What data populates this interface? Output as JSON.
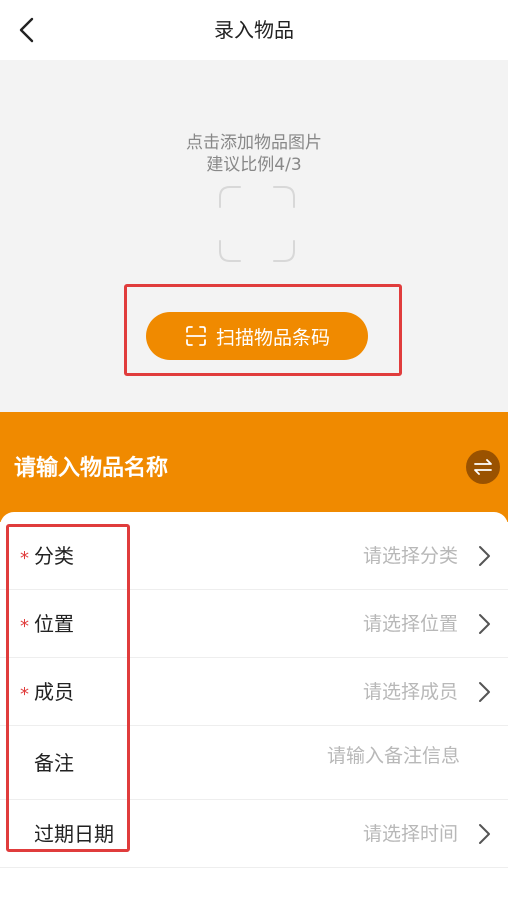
{
  "header": {
    "title": "录入物品",
    "back_icon": "chevron-left-icon"
  },
  "photo": {
    "hint_line1": "点击添加物品图片",
    "hint_line2": "建议比例4/3",
    "frame_icon": "image-frame-icon"
  },
  "scan": {
    "label": "扫描物品条码",
    "icon": "scan-icon",
    "color": "#f08a00"
  },
  "name": {
    "placeholder": "请输入物品名称",
    "swap_icon": "swap-icon",
    "band_color": "#f08a00"
  },
  "form": {
    "rows": [
      {
        "label": "分类",
        "required": "*",
        "value": "请选择分类",
        "chevron": true
      },
      {
        "label": "位置",
        "required": "*",
        "value": "请选择位置",
        "chevron": true
      },
      {
        "label": "成员",
        "required": "*",
        "value": "请选择成员",
        "chevron": true
      },
      {
        "label": "备注",
        "required": "",
        "value": "请输入备注信息",
        "chevron": false
      },
      {
        "label": "过期日期",
        "required": "",
        "value": "请选择时间",
        "chevron": true
      }
    ]
  },
  "annotation_color": "#e03c3c"
}
